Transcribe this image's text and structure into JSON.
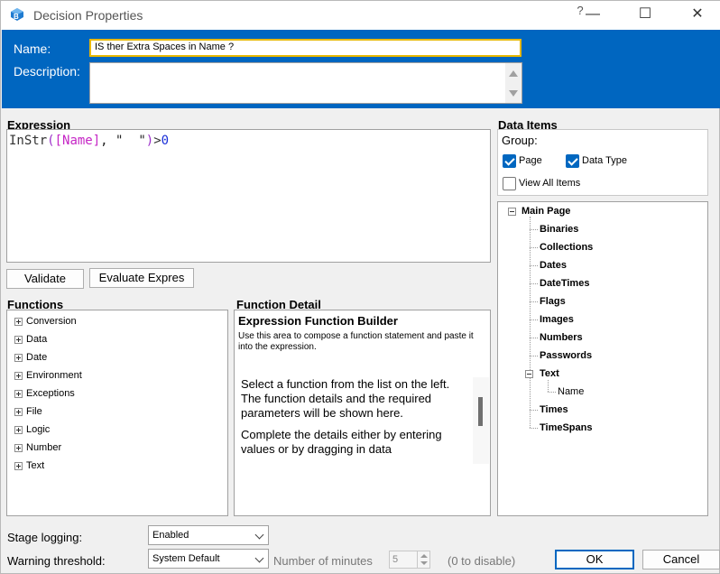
{
  "window": {
    "title": "Decision Properties",
    "help_glyph": "?",
    "minimize_glyph": "—",
    "maximize_glyph": "☐",
    "close_glyph": "✕"
  },
  "header": {
    "name_label": "Name:",
    "name_value": "IS ther Extra Spaces in Name ?",
    "description_label": "Description:",
    "description_value": ""
  },
  "expression": {
    "title": "Expression",
    "tokens": {
      "fn": "InStr",
      "open": "(",
      "field": "[Name]",
      "comma": ", ",
      "string": "\"  \"",
      "close": ")",
      "op": ">",
      "num": "0"
    },
    "validate_label": "Validate",
    "evaluate_label": "Evaluate Expres"
  },
  "functions": {
    "title": "Functions",
    "items": [
      "Conversion",
      "Data",
      "Date",
      "Environment",
      "Exceptions",
      "File",
      "Logic",
      "Number",
      "Text"
    ]
  },
  "function_detail": {
    "title": "Function Detail",
    "heading": "Expression Function Builder",
    "subtext": "Use this area to compose a function statement and paste it into the expression.",
    "body_1": "Select a function from the list on the left. The function details and the required parameters will be shown here.",
    "body_2": "Complete the details either by entering values or by dragging in data"
  },
  "data_items": {
    "title": "Data Items",
    "group_label": "Group:",
    "page_label": "Page",
    "page_checked": true,
    "datatype_label": "Data Type",
    "datatype_checked": true,
    "view_all_label": "View All Items",
    "view_all_checked": false,
    "tree_root": "Main Page",
    "tree": [
      "Binaries",
      "Collections",
      "Dates",
      "DateTimes",
      "Flags",
      "Images",
      "Numbers",
      "Passwords",
      "Text",
      "Times",
      "TimeSpans"
    ],
    "text_child": "Name"
  },
  "bottom": {
    "stage_logging_label": "Stage logging:",
    "stage_logging_value": "Enabled",
    "warning_label": "Warning threshold:",
    "warning_value": "System Default",
    "minutes_label": "Number of minutes",
    "minutes_value": "5",
    "disable_hint": "(0 to disable)",
    "ok_label": "OK",
    "cancel_label": "Cancel"
  }
}
